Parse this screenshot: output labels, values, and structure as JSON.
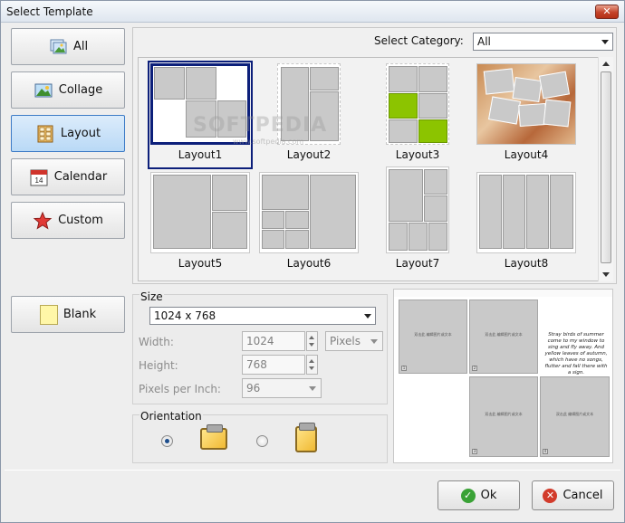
{
  "window": {
    "title": "Select Template"
  },
  "sidebar": {
    "items": [
      {
        "label": "All",
        "icon": "picture-icon"
      },
      {
        "label": "Collage",
        "icon": "photo-icon"
      },
      {
        "label": "Layout",
        "icon": "layout-grid-icon",
        "active": true
      },
      {
        "label": "Calendar",
        "icon": "calendar-icon",
        "day": "14"
      },
      {
        "label": "Custom",
        "icon": "star-icon"
      }
    ],
    "blank_label": "Blank"
  },
  "gallery": {
    "category_label": "Select Category:",
    "category_value": "All",
    "templates": [
      {
        "name": "Layout1",
        "selected": true
      },
      {
        "name": "Layout2"
      },
      {
        "name": "Layout3"
      },
      {
        "name": "Layout4"
      },
      {
        "name": "Layout5"
      },
      {
        "name": "Layout6"
      },
      {
        "name": "Layout7"
      },
      {
        "name": "Layout8"
      }
    ],
    "watermark": "SOFTPEDIA",
    "watermark_url": "www.softpedia.com"
  },
  "size": {
    "title": "Size",
    "preset": "1024 x 768",
    "width_label": "Width:",
    "width_value": "1024",
    "height_label": "Height:",
    "height_value": "768",
    "unit": "Pixels",
    "ppi_label": "Pixels per Inch:",
    "ppi_value": "96"
  },
  "orientation": {
    "title": "Orientation",
    "selected": "landscape"
  },
  "preview": {
    "cell_text": "双击此\n编辑图片或文本",
    "poem": "Stray birds of summer come to my window to sing and fly away. And yellow leaves of autumn, which have no songs, flutter and fall there with a sign.",
    "cell_numbers": [
      "1",
      "2",
      "3",
      "4"
    ]
  },
  "buttons": {
    "ok": "Ok",
    "cancel": "Cancel"
  },
  "colors": {
    "accent": "#0c1f7a",
    "active_tab": "#b9d9f6",
    "green": "#8cc400"
  }
}
